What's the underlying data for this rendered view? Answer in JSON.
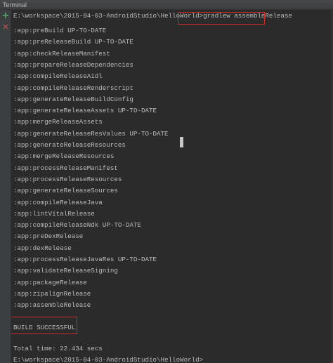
{
  "window": {
    "title": "Terminal"
  },
  "gutter": {
    "add_icon": "plus-icon",
    "close_icon": "close-icon",
    "add_glyph": "+",
    "close_glyph": "✕"
  },
  "colors": {
    "background": "#2b2b2b",
    "text": "#bbbbbb",
    "highlight_box": "#d12b2b",
    "add_icon": "#59a869",
    "close_icon": "#c75450"
  },
  "terminal": {
    "prompt": "E:\\workspace\\2015-04-03-AndroidStudio\\HelloWorld>",
    "command": "gradlew assembleRelease",
    "output": [
      ":app:preBuild UP-TO-DATE",
      ":app:preReleaseBuild UP-TO-DATE",
      ":app:checkReleaseManifest",
      ":app:prepareReleaseDependencies",
      ":app:compileReleaseAidl",
      ":app:compileReleaseRenderscript",
      ":app:generateReleaseBuildConfig",
      ":app:generateReleaseAssets UP-TO-DATE",
      ":app:mergeReleaseAssets",
      ":app:generateReleaseResValues UP-TO-DATE",
      ":app:generateReleaseResources",
      ":app:mergeReleaseResources",
      ":app:processReleaseManifest",
      ":app:processReleaseResources",
      ":app:generateReleaseSources",
      ":app:compileReleaseJava",
      ":app:lintVitalRelease",
      ":app:compileReleaseNdk UP-TO-DATE",
      ":app:preDexRelease",
      ":app:dexRelease",
      ":app:processReleaseJavaRes UP-TO-DATE",
      ":app:validateReleaseSigning",
      ":app:packageRelease",
      ":app:zipalignRelease",
      ":app:assembleRelease"
    ],
    "result": "BUILD SUCCESSFUL",
    "total_time": "Total time: 22.434 secs",
    "final_prompt": "E:\\workspace\\2015-04-03-AndroidStudio\\HelloWorld>"
  }
}
